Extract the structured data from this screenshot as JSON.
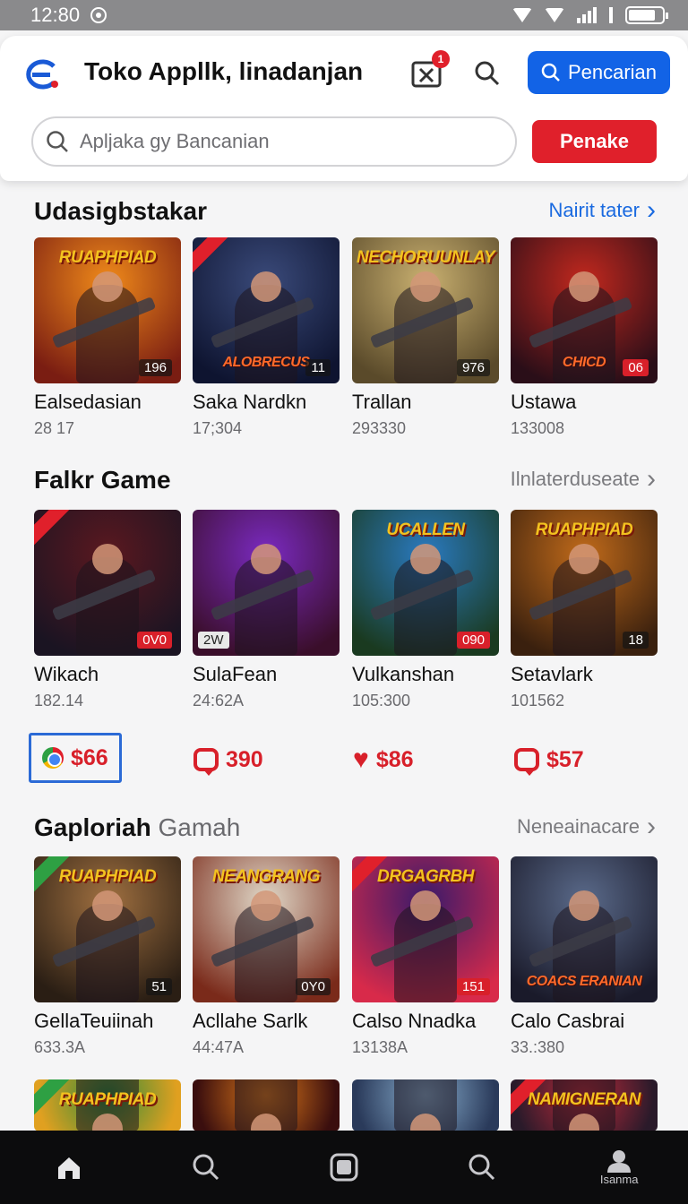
{
  "status_bar": {
    "time": "12:80"
  },
  "header": {
    "title": "Toko Appllk, linadanjan",
    "notification_count": "1",
    "search_button_label": "Pencarian",
    "search_placeholder": "Apljaka gy Bancanian",
    "action_button_label": "Penake"
  },
  "sections": [
    {
      "title": "Udasigbstakar",
      "link": "Nairit tater",
      "cards": [
        {
          "name": "Ealsedasian",
          "sub": "28 17",
          "badge": "196",
          "logo": "RUAPHPIAD",
          "colors": [
            "#f08a1a",
            "#7a1d12"
          ]
        },
        {
          "name": "Saka Nardkn",
          "sub": "17;304",
          "badge": "11",
          "logo": "ALOBRECUS",
          "colors": [
            "#3a4a7a",
            "#0e1430"
          ]
        },
        {
          "name": "Trallan",
          "sub": "293330",
          "badge": "976",
          "logo": "NECHORUUNLAY",
          "colors": [
            "#c9b070",
            "#5a4a2a"
          ]
        },
        {
          "name": "Ustawa",
          "sub": "133008",
          "badge": "06",
          "logo": "CHICD",
          "colors": [
            "#c2281e",
            "#2a0e18"
          ]
        }
      ]
    },
    {
      "title": "Falkr Game",
      "link": "Ilnlaterduseate",
      "cards": [
        {
          "name": "Wikach",
          "sub": "182.14",
          "badge": "0V0",
          "logo": "",
          "colors": [
            "#5a1820",
            "#1a1422"
          ]
        },
        {
          "name": "SulaFean",
          "sub": "24:62A",
          "badge": "2W",
          "logo": "",
          "colors": [
            "#7a2ac0",
            "#3a0e2a"
          ]
        },
        {
          "name": "Vulkanshan",
          "sub": "105:300",
          "badge": "090",
          "logo": "UCALLEN",
          "colors": [
            "#2a7ac0",
            "#1a3a20"
          ]
        },
        {
          "name": "Setavlark",
          "sub": "101562",
          "badge": "18",
          "logo": "RUAPHPIAD",
          "colors": [
            "#c06a1a",
            "#3a200e"
          ]
        }
      ]
    },
    {
      "title": "Gaploriah",
      "title_muted": "Gamah",
      "link": "Neneainacare",
      "cards": [
        {
          "name": "GellaTeuiinah",
          "sub": "633.3A",
          "badge": "51",
          "logo": "RUAPHPIAD",
          "colors": [
            "#a07040",
            "#2a1e14"
          ]
        },
        {
          "name": "Acllahe Sarlk",
          "sub": "44:47A",
          "badge": "0Y0",
          "logo": "NEANGRANG",
          "colors": [
            "#e0d8c8",
            "#7a2a1a"
          ]
        },
        {
          "name": "Calso Nnadka",
          "sub": "13138A",
          "badge": "151",
          "logo": "DRGAGRBH",
          "colors": [
            "#3a1a6a",
            "#d82a4a"
          ]
        },
        {
          "name": "Calo Casbrai",
          "sub": "33.:380",
          "badge": "",
          "logo": "COACS ERANIAN",
          "colors": [
            "#5a6a8a",
            "#1a1a2a"
          ]
        }
      ]
    }
  ],
  "prices": [
    {
      "value": "$66",
      "icon": "chrome-icon"
    },
    {
      "value": "390",
      "icon": "chat-bubble-icon"
    },
    {
      "value": "$86",
      "icon": "heart-icon"
    },
    {
      "value": "$57",
      "icon": "chat-bubble-icon"
    }
  ],
  "partial_row": [
    {
      "logo": "RUAPHPIAD",
      "colors": [
        "#2a8a3a",
        "#e0a020"
      ]
    },
    {
      "logo": "",
      "colors": [
        "#e07a1a",
        "#3a0e0e"
      ]
    },
    {
      "logo": "",
      "colors": [
        "#8ab0d0",
        "#2a3a5a"
      ]
    },
    {
      "logo": "NAMIGNERAN",
      "colors": [
        "#c02a3a",
        "#2a1a2a"
      ]
    }
  ],
  "bottom_nav": {
    "profile_label": "Isanma"
  }
}
